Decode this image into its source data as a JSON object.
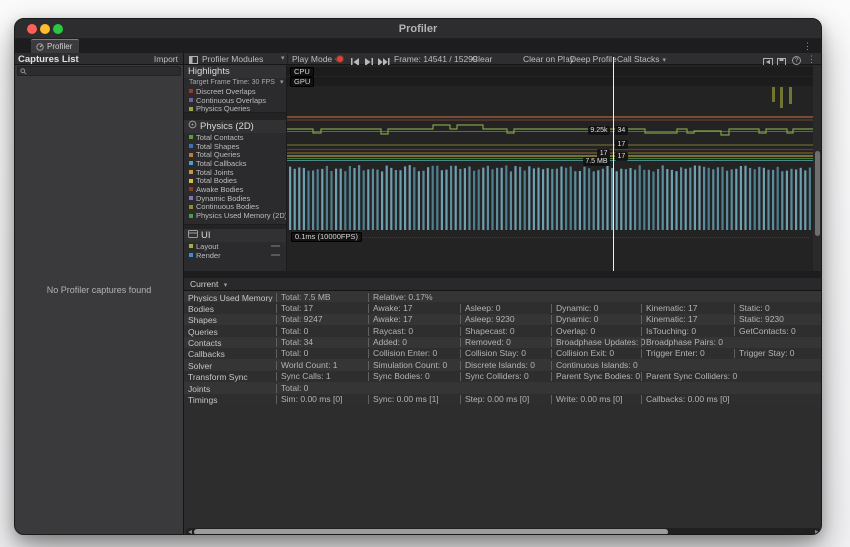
{
  "window": {
    "title": "Profiler"
  },
  "tabbar": {
    "tab_label": "Profiler"
  },
  "icons": {
    "dropdown_arrow": "▾",
    "overflow_menu": "⋮",
    "help": "?"
  },
  "captures_panel": {
    "title": "Captures List",
    "import_label": "Import",
    "search_placeholder": "",
    "empty_message": "No Profiler captures found"
  },
  "toolbar": {
    "profiler_modules_label": "Profiler Modules",
    "play_mode_label": "Play Mode",
    "frame_info": "Frame: 14541 / 15299",
    "clear_label": "Clear",
    "clear_on_play_label": "Clear on Play",
    "deep_profile_label": "Deep Profile",
    "call_stacks_label": "Call Stacks"
  },
  "modules": [
    {
      "name": "Highlights",
      "subtitle": "Target Frame Time: 30 FPS",
      "legend": [
        {
          "label": "Discreet Overlaps",
          "color": "#993636"
        },
        {
          "label": "Continuous Overlaps",
          "color": "#7a5fa0"
        },
        {
          "label": "Physics Queries",
          "color": "#9aa437"
        }
      ]
    },
    {
      "name": "Physics (2D)",
      "legend": [
        {
          "label": "Total Contacts",
          "color": "#55a038"
        },
        {
          "label": "Total Shapes",
          "color": "#3f6fb5"
        },
        {
          "label": "Total Queries",
          "color": "#c17a2f"
        },
        {
          "label": "Total Callbacks",
          "color": "#4da0c4"
        },
        {
          "label": "Total Joints",
          "color": "#c79a35"
        },
        {
          "label": "Total Bodies",
          "color": "#cfc13a"
        },
        {
          "label": "Awake Bodies",
          "color": "#8a3a2a"
        },
        {
          "label": "Dynamic Bodies",
          "color": "#8a70c2"
        },
        {
          "label": "Continuous Bodies",
          "color": "#968a2c"
        },
        {
          "label": "Physics Used Memory (2D)",
          "color": "#46a046"
        }
      ]
    },
    {
      "name": "UI",
      "legend": [
        {
          "label": "Layout",
          "color": "#a0b23c"
        },
        {
          "label": "Render",
          "color": "#4788c7"
        }
      ]
    }
  ],
  "chart": {
    "cpu_lane_label": "CPU",
    "gpu_lane_label": "GPU",
    "ui_lane_label": "0.1ms (10000FPS)",
    "markers": [
      {
        "text": "9.25k",
        "side": "left"
      },
      {
        "text": "34",
        "side": "right"
      },
      {
        "text": "17",
        "side": "right"
      },
      {
        "text": "17",
        "side": "left"
      },
      {
        "text": "17",
        "side": "right"
      },
      {
        "text": "7.5 MB",
        "side": "left"
      }
    ]
  },
  "details": {
    "view_selector_label": "Current",
    "rows": [
      {
        "label": "Physics Used Memory",
        "cells": [
          "Total: 7.5 MB",
          "Relative: 0.17%"
        ]
      },
      {
        "label": "Bodies",
        "cells": [
          "Total: 17",
          "Awake: 17",
          "Asleep: 0",
          "Dynamic: 0",
          "Kinematic: 17",
          "Static: 0"
        ]
      },
      {
        "label": "Shapes",
        "cells": [
          "Total: 9247",
          "Awake: 17",
          "Asleep: 9230",
          "Dynamic: 0",
          "Kinematic: 17",
          "Static: 9230"
        ]
      },
      {
        "label": "Queries",
        "cells": [
          "Total: 0",
          "Raycast: 0",
          "Shapecast: 0",
          "Overlap: 0",
          "IsTouching: 0",
          "GetContacts: 0"
        ]
      },
      {
        "label": "Contacts",
        "cells": [
          "Total: 34",
          "Added: 0",
          "Removed: 0",
          "Broadphase Updates: 0",
          "Broadphase Pairs: 0"
        ]
      },
      {
        "label": "Callbacks",
        "cells": [
          "Total: 0",
          "Collision Enter: 0",
          "Collision Stay: 0",
          "Collision Exit: 0",
          "Trigger Enter: 0",
          "Trigger Stay: 0"
        ]
      },
      {
        "label": "Solver",
        "cells": [
          "World Count: 1",
          "Simulation Count: 0",
          "Discrete Islands: 0",
          "Continuous Islands: 0"
        ]
      },
      {
        "label": "Transform Sync",
        "cells": [
          "Sync Calls: 1",
          "Sync Bodies: 0",
          "Sync Colliders: 0",
          "Parent Sync Bodies: 0",
          "Parent Sync Colliders: 0"
        ]
      },
      {
        "label": "Joints",
        "cells": [
          "Total: 0"
        ]
      },
      {
        "label": "Timings",
        "cells": [
          "Sim: 0.00 ms [0]",
          "Sync: 0.00 ms [1]",
          "Step: 0.00 ms [0]",
          "Write: 0.00 ms [0]",
          "Callbacks: 0.00 ms [0]"
        ]
      }
    ]
  }
}
